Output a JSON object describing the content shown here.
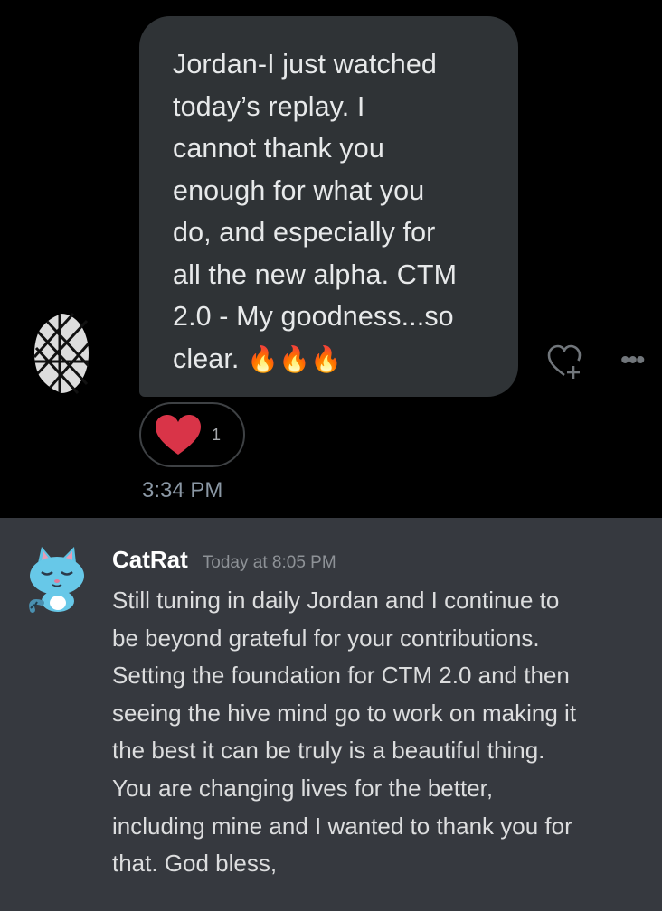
{
  "dm": {
    "message_text": "Jordan-I just watched\ntoday’s replay. I\ncannot thank you\nenough for what you\ndo, and especially for\nall the new alpha. CTM\n2.0 - My goodness...so\nclear. ",
    "emoji": "🔥🔥🔥",
    "reaction": {
      "icon": "heart-icon",
      "count": "1"
    },
    "timestamp": "3:34 PM",
    "actions": {
      "react_icon": "heart-plus-icon",
      "more_icon": "more-icon"
    },
    "colors": {
      "bubble": "#2f3336",
      "background": "#000000",
      "heart": "#e0245e"
    }
  },
  "discord": {
    "username": "CatRat",
    "time": "Today at 8:05 PM",
    "message": "Still tuning in daily Jordan and I continue to\nbe beyond grateful for your contributions.\nSetting the foundation for CTM 2.0 and then\nseeing the hive mind go to work on making it\nthe best it can be truly is a beautiful thing.\nYou are changing lives for the better,\nincluding mine and I wanted to thank you for\nthat. God bless,",
    "colors": {
      "background": "#36393f",
      "text": "#dcddde",
      "muted": "#8e9297"
    }
  }
}
